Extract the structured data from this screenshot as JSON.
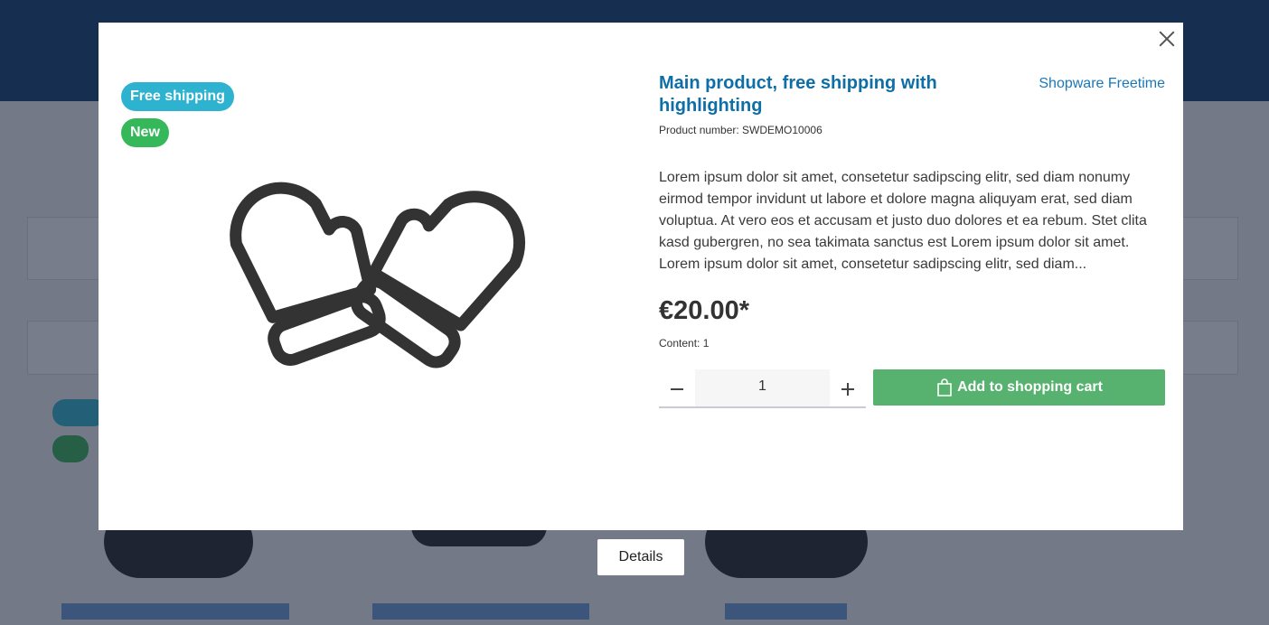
{
  "product": {
    "badges": {
      "shipping": "Free shipping",
      "new": "New"
    },
    "title": "Main product, free shipping with highlighting",
    "manufacturer": "Shopware Freetime",
    "product_number": "Product number: SWDEMO10006",
    "description": "Lorem ipsum dolor sit amet, consetetur sadipscing elitr, sed diam nonumy eirmod tempor invidunt ut labore et dolore magna aliquyam erat, sed diam voluptua. At vero eos et accusam et justo duo dolores et ea rebum. Stet clita kasd gubergren, no sea takimata sanctus est Lorem ipsum dolor sit amet. Lorem ipsum dolor sit amet, consetetur sadipscing elitr, sed diam...",
    "price": "€20.00*",
    "content": "Content: 1",
    "quantity": "1",
    "add_to_cart_label": "Add to shopping cart",
    "image_icon": "mittens-icon"
  },
  "modal": {
    "details_label": "Details"
  },
  "colors": {
    "title": "#0e6ea6",
    "badge_shipping": "#2db3d0",
    "badge_new": "#35b85a",
    "cart_button": "#58b26f"
  }
}
